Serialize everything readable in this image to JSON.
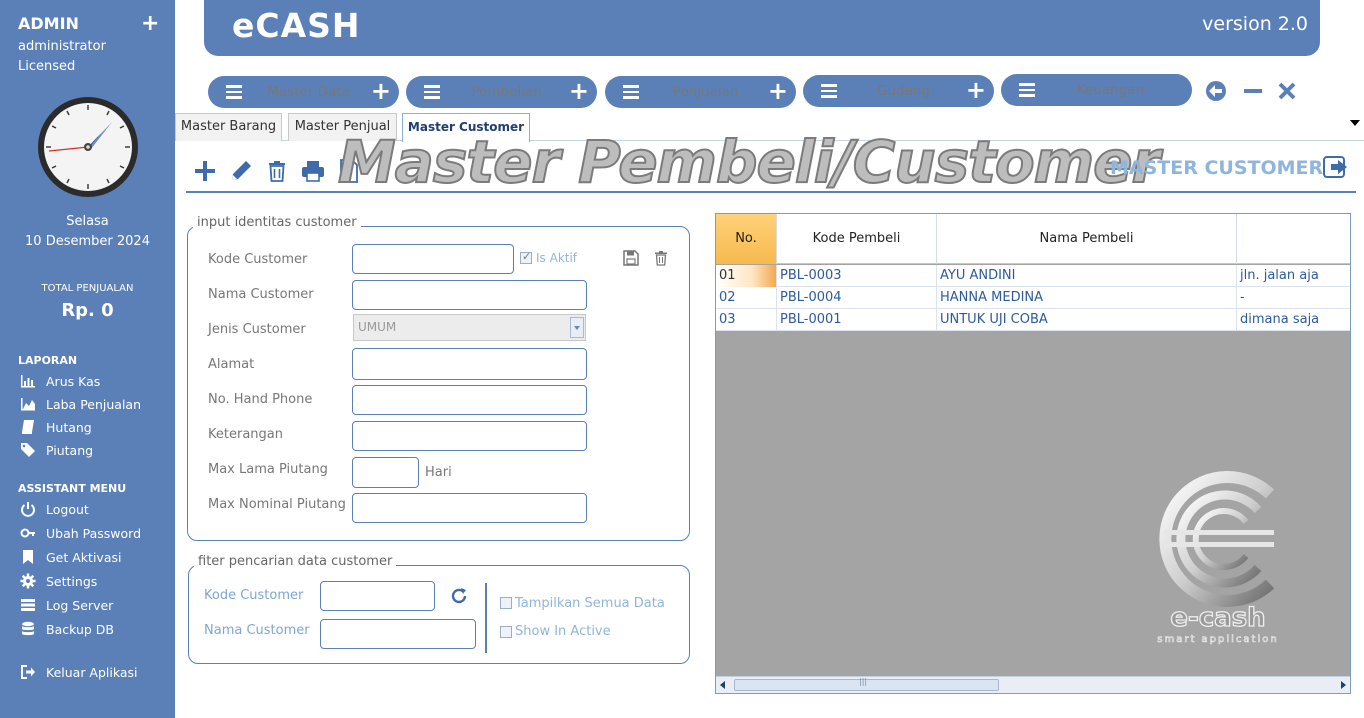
{
  "sidebar": {
    "admin": "ADMIN",
    "role": "administrator",
    "license": "Licensed",
    "day": "Selasa",
    "date": "10 Desember 2024",
    "total_label": "TOTAL PENJUALAN",
    "total_value": "Rp. 0",
    "laporan_title": "LAPORAN",
    "laporan": [
      {
        "label": "Arus Kas",
        "icon": "bar-chart-icon"
      },
      {
        "label": "Laba Penjualan",
        "icon": "area-chart-icon"
      },
      {
        "label": "Hutang",
        "icon": "book-icon"
      },
      {
        "label": "Piutang",
        "icon": "tags-icon"
      }
    ],
    "assistant_title": "ASSISTANT MENU",
    "assistant": [
      {
        "label": "Logout",
        "icon": "power-icon"
      },
      {
        "label": "Ubah Password",
        "icon": "key-icon"
      },
      {
        "label": "Get Aktivasi",
        "icon": "bookmark-icon"
      },
      {
        "label": "Settings",
        "icon": "gear-icon"
      },
      {
        "label": "Log Server",
        "icon": "server-icon"
      },
      {
        "label": "Backup DB",
        "icon": "database-icon"
      }
    ],
    "exit": "Keluar Aplikasi"
  },
  "header": {
    "title": "eCASH",
    "version": "version 2.0"
  },
  "menu": [
    "Master Data",
    "Pembelian",
    "Penjualan",
    "Gudang",
    "Keuangan"
  ],
  "tabs": [
    "Master Barang",
    "Master Penjual",
    "Master Customer"
  ],
  "active_tab": 2,
  "watermark": "Master Pembeli/Customer",
  "form_title": "MASTER CUSTOMER",
  "identity": {
    "legend": "input identitas customer",
    "kode_label": "Kode Customer",
    "kode_value": "",
    "is_aktif_label": "Is Aktif",
    "is_aktif": true,
    "nama_label": "Nama Customer",
    "jenis_label": "Jenis Customer",
    "jenis_value": "UMUM",
    "alamat_label": "Alamat",
    "hp_label": "No. Hand Phone",
    "ket_label": "Keterangan",
    "max_lama_label": "Max Lama Piutang",
    "hari_label": "Hari",
    "max_nominal_label": "Max Nominal Piutang"
  },
  "filter": {
    "legend": "fiter pencarian data customer",
    "kode_label": "Kode Customer",
    "nama_label": "Nama Customer",
    "show_all_label": "Tampilkan Semua Data",
    "show_inactive_label": "Show In Active"
  },
  "grid": {
    "columns": [
      "No.",
      "Kode Pembeli",
      "Nama Pembeli",
      ""
    ],
    "rows": [
      [
        "01",
        "PBL-0003",
        "AYU ANDINI",
        "jln. jalan aja"
      ],
      [
        "02",
        "PBL-0004",
        "HANNA MEDINA",
        "-"
      ],
      [
        "03",
        "PBL-0001",
        "UNTUK UJI COBA",
        "dimana saja"
      ]
    ]
  },
  "logo": {
    "wordmark": "e-cash",
    "tagline": "smart application"
  },
  "colors": {
    "primary": "#5b80b8",
    "accent_light": "#8fb5dc",
    "grid_bg": "#a4a4a4"
  }
}
